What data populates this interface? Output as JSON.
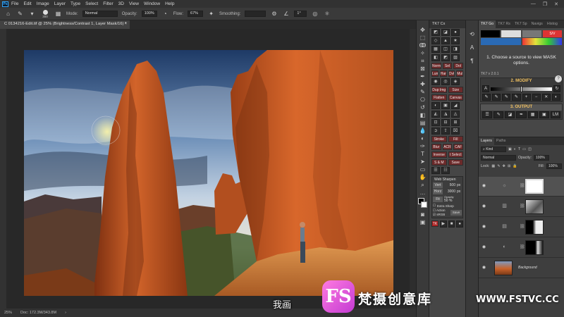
{
  "app": {
    "logo": "Ps",
    "menu": [
      "File",
      "Edit",
      "Image",
      "Layer",
      "Type",
      "Select",
      "Filter",
      "3D",
      "View",
      "Window",
      "Help"
    ],
    "window_controls": [
      "—",
      "❐",
      "✕"
    ]
  },
  "options_bar": {
    "brush_size": "300",
    "mode_label": "Mode:",
    "mode_value": "Normal",
    "opacity_label": "Opacity:",
    "opacity_value": "100%",
    "flow_label": "Flow:",
    "flow_value": "67%",
    "smoothing_label": "Smoothing:",
    "angle_value": "1°"
  },
  "document": {
    "tab_title": "C 0134216-Edit.tif @ 25% (Brightness/Contrast 1, Layer Mask/16) *",
    "close": "×"
  },
  "status_bar": {
    "zoom": "25%",
    "doc_info": "Doc: 172.3M/343.8M"
  },
  "tk7_cx": {
    "title": "TK7 Cx",
    "rows": [
      [
        "Norm Sel",
        "Sel",
        "Dol"
      ],
      [
        "Lum",
        "Hard",
        "Ovl",
        "Mul"
      ],
      [
        "Dup Img",
        "Size"
      ],
      [
        "Flatten",
        "Canvas"
      ],
      [
        "Stroke",
        "Fill"
      ],
      [
        "Blur",
        "ACR",
        "CAF"
      ],
      [
        "Inverse",
        "t Select"
      ],
      [
        "S & M",
        "Save"
      ]
    ],
    "web_sharpen": {
      "title": "Web Sharpen",
      "vert_label": "Vert",
      "vert_value": "500",
      "horz_label": "Horz",
      "horz_value": "3000",
      "unit": "px",
      "fit_label": "Fit",
      "opacity_label": "Opacity",
      "opacity_value": "50",
      "pct": "%",
      "extra_sharp": "Extra Sharp",
      "action": "Action",
      "srgb": "sRGB",
      "save": "Save"
    },
    "footer": "TK"
  },
  "tk7_go": {
    "tabs": [
      "TK7 Go",
      "TK7 Rs",
      "TK7 Sp",
      "Navigs",
      "Histog"
    ],
    "chips": [
      "",
      "",
      "",
      "S/V"
    ],
    "message": "1. Choose a source to view MASK options.",
    "version": "TK7 v 2.0.1",
    "modify_header": "2. MODIFY",
    "output_header": "3. OUTPUT",
    "lm_label": "LM"
  },
  "layers_panel": {
    "tabs": [
      "Layers",
      "Paths"
    ],
    "kind_value": "Kind",
    "blend_value": "Normal",
    "opacity_label": "Opacity:",
    "opacity_value": "100%",
    "lock_label": "Lock:",
    "fill_label": "Fill:",
    "fill_value": "100%",
    "layers": [
      {
        "name": "",
        "type": "adjustment"
      },
      {
        "name": "",
        "type": "adjustment"
      },
      {
        "name": "",
        "type": "adjustment"
      },
      {
        "name": "",
        "type": "adjustment"
      },
      {
        "name": "Background",
        "type": "background"
      }
    ]
  },
  "overlay": {
    "subtitle": "我画",
    "watermark_logo": "FS",
    "watermark_text": "梵摄创意库",
    "watermark_url": "WWW.FSTVC.CC"
  },
  "colors": {
    "ps_blue": "#31a8ff",
    "tk_red": "#6b2a2a",
    "modify_yellow": "#f0c060",
    "watermark_pink": "#c33bd3"
  }
}
